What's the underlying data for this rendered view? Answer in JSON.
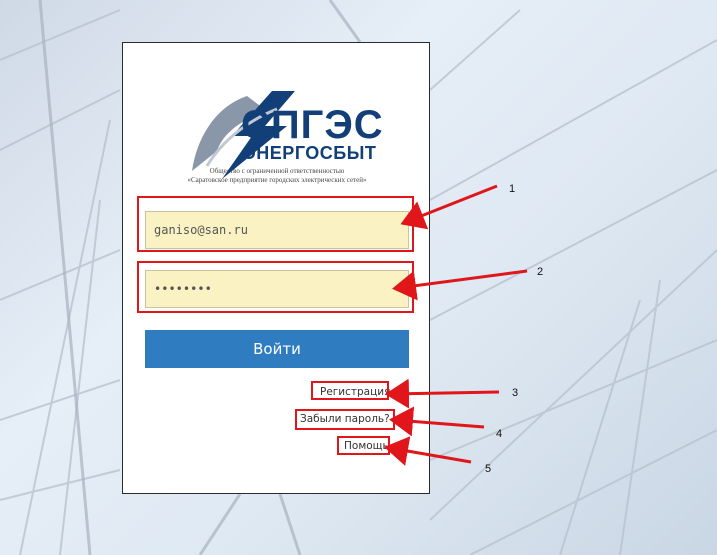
{
  "brand": {
    "name": "СПГЭС",
    "subtitle": "ЭНЕРГОСБЫТ",
    "caption_line1": "Общество с ограниченной ответственностью",
    "caption_line2": "«Саратовское предприятие городских электрических сетей»",
    "logo_icon": "lightning-bolt-icon",
    "color": "#123f78"
  },
  "form": {
    "email_value": "ganiso@san.ru",
    "password_value": "••••••••",
    "login_label": "Войти",
    "login_color": "#2f7cc0"
  },
  "links": {
    "register": "Регистрация",
    "forgot": "Забыли пароль?",
    "help": "Помощь"
  },
  "annotations": {
    "n1": "1",
    "n2": "2",
    "n3": "3",
    "n4": "4",
    "n5": "5",
    "color": "#e0161b"
  }
}
